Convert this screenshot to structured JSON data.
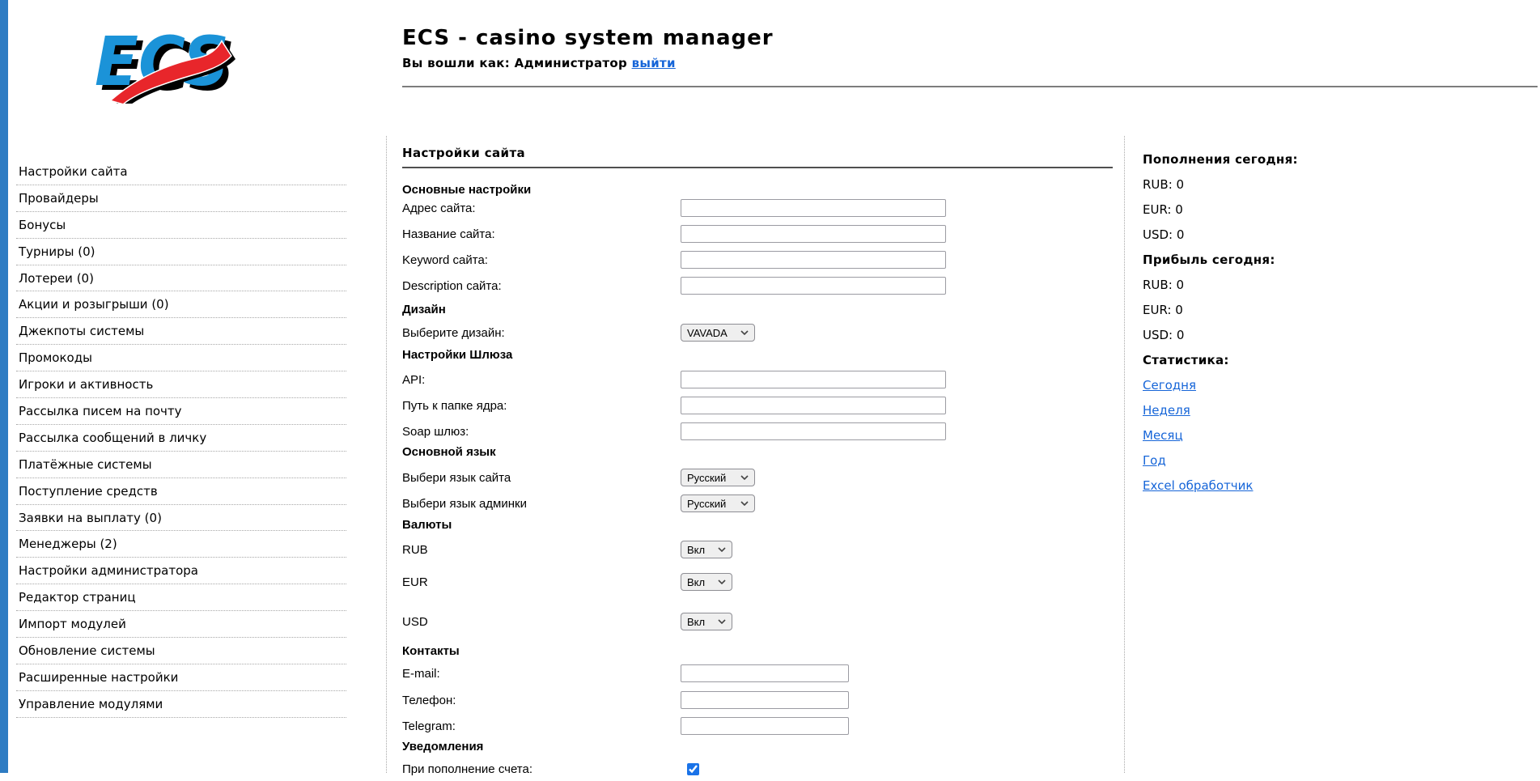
{
  "colors": {
    "link_blue": "#1665d8",
    "checkbox_accent": "#1a73e8",
    "logo_blue": "#1b93d8",
    "logo_red": "#e8262b",
    "edge_bar_blue": "#2e7cc3"
  },
  "header": {
    "logo_text": "ECS",
    "title": "ECS - casino system manager",
    "login_prefix": "Вы вошли как: Администратор",
    "logout_label": "выйти"
  },
  "sidebar": {
    "items": [
      "Настройки сайта",
      "Провайдеры",
      "Бонусы",
      "Турниры (0)",
      "Лотереи (0)",
      "Акции и розыгрыши (0)",
      "Джекпоты системы",
      "Промокоды",
      "Игроки и активность",
      "Рассылка писем на почту",
      "Рассылка сообщений в личку",
      "Платёжные системы",
      "Поступление средств",
      "Заявки на выплату (0)",
      "Менеджеры (2)",
      "Настройки администратора",
      "Редактор страниц",
      "Импорт модулей",
      "Обновление системы",
      "Расширенные настройки",
      "Управление модулями"
    ]
  },
  "main": {
    "title": "Настройки сайта",
    "sec_general": "Основные настройки",
    "f_address": {
      "label": "Адрес сайта:",
      "value": ""
    },
    "f_sitename": {
      "label": "Название сайта:",
      "value": ""
    },
    "f_keyword": {
      "label": "Keyword сайта:",
      "value": ""
    },
    "f_description": {
      "label": "Description сайта:",
      "value": ""
    },
    "sec_design": "Дизайн",
    "f_design": {
      "label": "Выберите дизайн:",
      "value": "VAVADA"
    },
    "sec_gateway": "Настройки Шлюза",
    "f_api": {
      "label": "API:",
      "value": ""
    },
    "f_core_path": {
      "label": "Путь к папке ядра:",
      "value": ""
    },
    "f_soap": {
      "label": "Soap шлюз:",
      "value": ""
    },
    "sec_language": "Основной язык",
    "f_site_lang": {
      "label": "Выбери язык сайта",
      "value": "Русский"
    },
    "f_admin_lang": {
      "label": "Выбери язык админки",
      "value": "Русский"
    },
    "sec_currencies": "Валюты",
    "f_rub": {
      "label": "RUB",
      "value": "Вкл"
    },
    "f_eur": {
      "label": "EUR",
      "value": "Вкл"
    },
    "f_usd": {
      "label": "USD",
      "value": "Вкл"
    },
    "sec_contacts": "Контакты",
    "f_email": {
      "label": "E-mail:",
      "value": ""
    },
    "f_phone": {
      "label": "Телефон:",
      "value": ""
    },
    "f_telegram": {
      "label": "Telegram:",
      "value": ""
    },
    "sec_notifications": "Уведомления",
    "f_deposit_notice": {
      "label": "При пополнение счета:",
      "checked": true
    }
  },
  "stats": {
    "deposits_heading": "Пополнения сегодня:",
    "deposits_today": [
      "RUB: 0",
      "EUR: 0",
      "USD: 0"
    ],
    "profit_heading": "Прибыль сегодня:",
    "profit_today": [
      "RUB: 0",
      "EUR: 0",
      "USD: 0"
    ],
    "statistics_heading": "Статистика:",
    "links": [
      "Сегодня",
      "Неделя",
      "Месяц",
      "Год",
      "Excel обработчик"
    ]
  }
}
